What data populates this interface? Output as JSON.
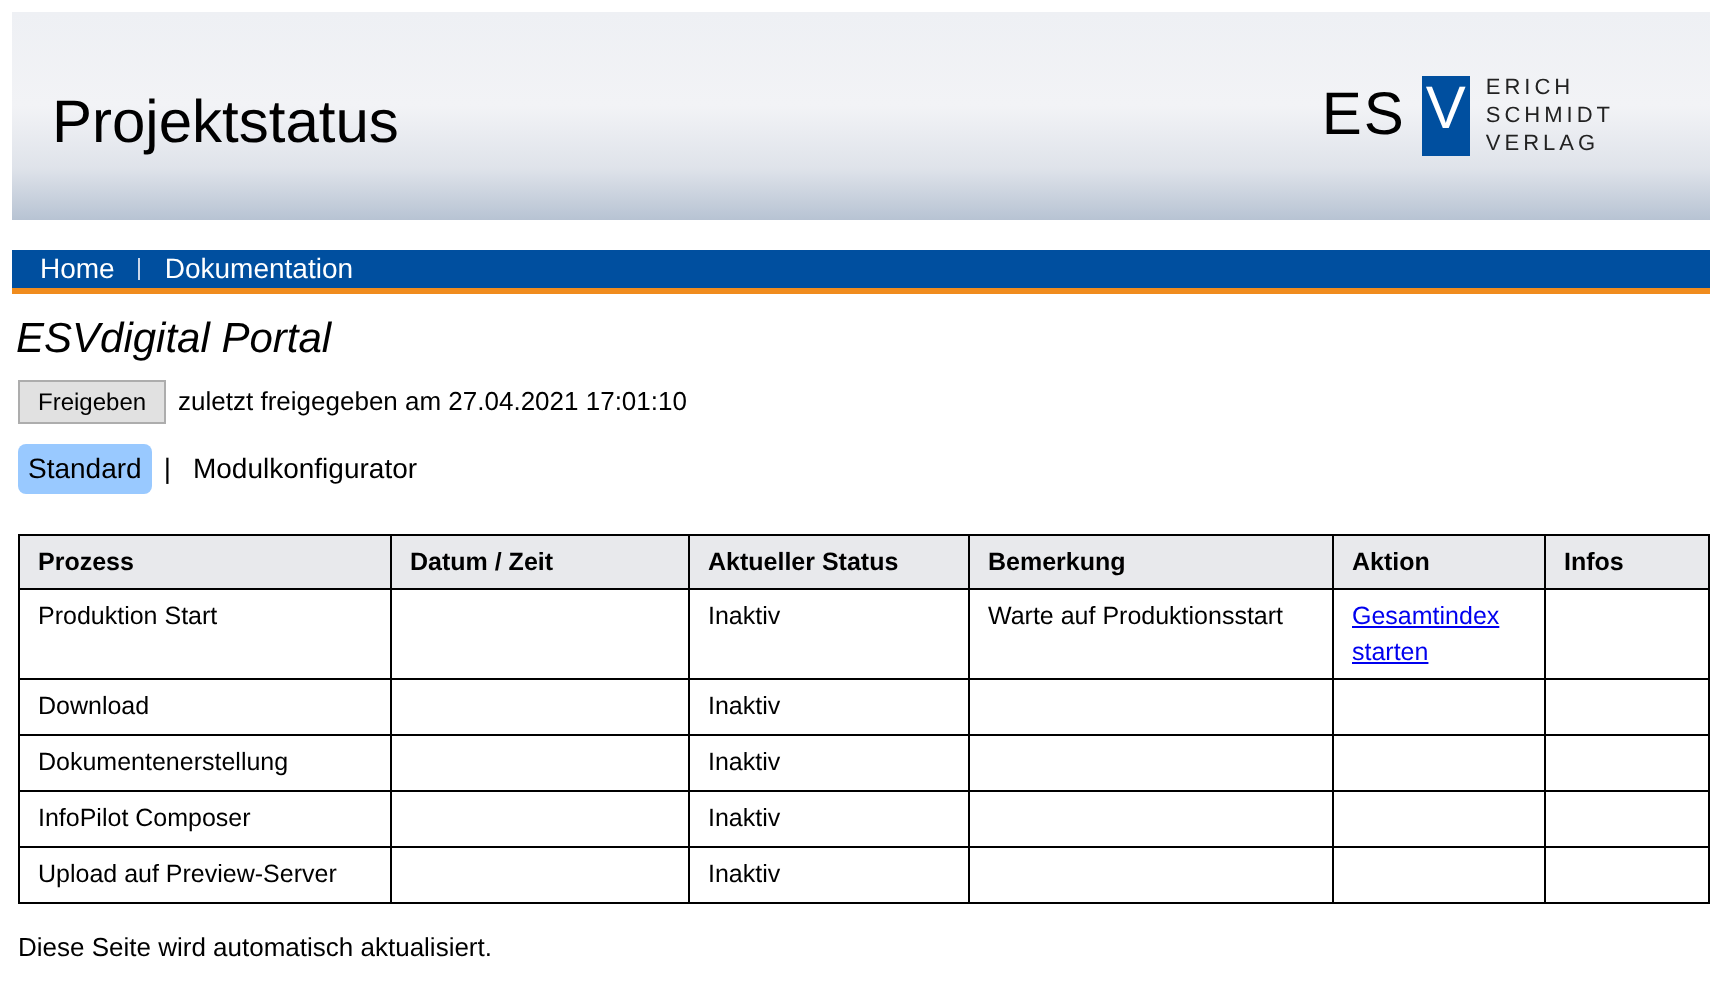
{
  "header": {
    "title": "Projektstatus",
    "logo": {
      "letters": "ES",
      "mark": "V",
      "lines": [
        "ERICH",
        "SCHMIDT",
        "VERLAG"
      ]
    }
  },
  "nav": [
    "Home",
    "Dokumentation"
  ],
  "portal_title": "ESVdigital Portal",
  "release": {
    "button": "Freigeben",
    "info": "zuletzt freigegeben am 27.04.2021 17:01:10"
  },
  "tabs": [
    {
      "label": "Standard",
      "selected": true
    },
    {
      "label": "Modulkonfigurator",
      "selected": false
    }
  ],
  "tabs_separator": "|",
  "table": {
    "columns": [
      "Prozess",
      "Datum / Zeit",
      "Aktueller Status",
      "Bemerkung",
      "Aktion",
      "Infos"
    ],
    "rows": [
      {
        "cells": [
          {
            "kind": "text",
            "text": "Produktion Start"
          },
          {
            "kind": "empty"
          },
          {
            "kind": "text",
            "text": "Inaktiv"
          },
          {
            "kind": "text",
            "text": "Warte auf Produktionsstart"
          },
          {
            "kind": "link",
            "text": "Gesamtindex starten"
          },
          {
            "kind": "empty"
          }
        ]
      },
      {
        "cells": [
          {
            "kind": "text",
            "text": "Download"
          },
          {
            "kind": "empty"
          },
          {
            "kind": "text",
            "text": "Inaktiv"
          },
          {
            "kind": "empty"
          },
          {
            "kind": "empty"
          },
          {
            "kind": "empty"
          }
        ]
      },
      {
        "cells": [
          {
            "kind": "text",
            "text": "Dokumentenerstellung"
          },
          {
            "kind": "empty"
          },
          {
            "kind": "text",
            "text": "Inaktiv"
          },
          {
            "kind": "empty"
          },
          {
            "kind": "empty"
          },
          {
            "kind": "empty"
          }
        ]
      },
      {
        "cells": [
          {
            "kind": "text",
            "text": "InfoPilot Composer"
          },
          {
            "kind": "empty"
          },
          {
            "kind": "text",
            "text": "Inaktiv"
          },
          {
            "kind": "empty"
          },
          {
            "kind": "empty"
          },
          {
            "kind": "empty"
          }
        ]
      },
      {
        "cells": [
          {
            "kind": "text",
            "text": "Upload auf Preview-Server"
          },
          {
            "kind": "empty"
          },
          {
            "kind": "text",
            "text": "Inaktiv"
          },
          {
            "kind": "empty"
          },
          {
            "kind": "empty"
          },
          {
            "kind": "empty"
          }
        ]
      }
    ]
  },
  "footer_note": "Diese Seite wird automatisch aktualisiert."
}
